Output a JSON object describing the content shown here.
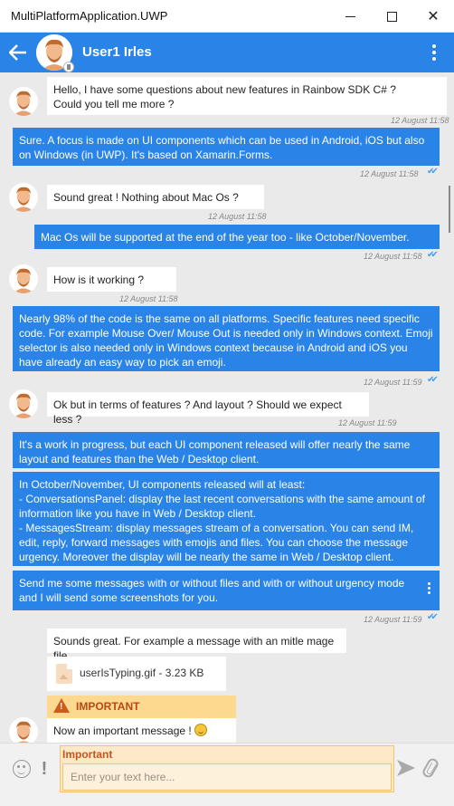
{
  "window": {
    "title": "MultiPlatformApplication.UWP"
  },
  "header": {
    "contact_name": "User1 Irles"
  },
  "colors": {
    "brand_blue": "#2a84e8",
    "chat_bg": "#eaeaea",
    "urgency_orange": "#fcd98f",
    "check_blue": "#4a9ee8"
  },
  "messages": [
    {
      "side": "in",
      "text": "Hello, I have some questions about new features in Rainbow SDK C# ?\nCould you tell me more ?",
      "time": "12 August 11:58"
    },
    {
      "side": "out",
      "text": "Sure. A focus is made on UI components which can be used in Android, iOS but also on Windows (in UWP). It's based on Xamarin.Forms.",
      "time": "12 August 11:58"
    },
    {
      "side": "in",
      "text": "Sound great ! Nothing about Mac Os ?",
      "time": "12 August 11:58"
    },
    {
      "side": "out",
      "text": "Mac Os will be supported at the end of the year too - like October/November.",
      "time": "12 August 11:58"
    },
    {
      "side": "in",
      "text": "How is it working ?",
      "time": "12 August 11:58"
    },
    {
      "side": "out",
      "text": "Nearly 98% of the code is the same on all platforms. Specific features need specific code. For example Mouse Over/ Mouse Out is needed only in Windows context. Emoji selector is also needed only in Windows context because in Android and iOS you have already an easy way to pick an emoji.",
      "time": "12 August 11:59"
    },
    {
      "side": "in",
      "text": "Ok but in terms of features ? And layout ? Should we expect less ?",
      "time": "12 August 11:59"
    },
    {
      "side": "out",
      "text": "It's a work in progress, but each UI component released will offer nearly the same layout and features than the Web / Desktop client."
    },
    {
      "side": "out",
      "text": "In October/November, UI components released will at least:\n- ConversationsPanel: display the last recent conversations with the same amount of information like you have in Web / Desktop client.\n- MessagesStream: display messages stream of a conversation. You can send IM, edit, reply, forward messages with emojis and files. You can choose the message urgency. Moreover the display will be nearly the same in Web / Desktop client."
    },
    {
      "side": "out",
      "text": "Send me some messages with or without files and with or without urgency mode and I will send some screenshots for you.",
      "time": "12 August 11:59"
    },
    {
      "side": "in",
      "text": "Sounds great. For example a message with an mitle mage file"
    },
    {
      "side": "in",
      "file_name": "userIsTyping.gif - 3.23 KB"
    },
    {
      "side": "in",
      "urgency_label": "IMPORTANT",
      "text": "Now an important message !"
    }
  ],
  "composer": {
    "urgency_title": "Important",
    "placeholder": "Enter your text here..."
  }
}
